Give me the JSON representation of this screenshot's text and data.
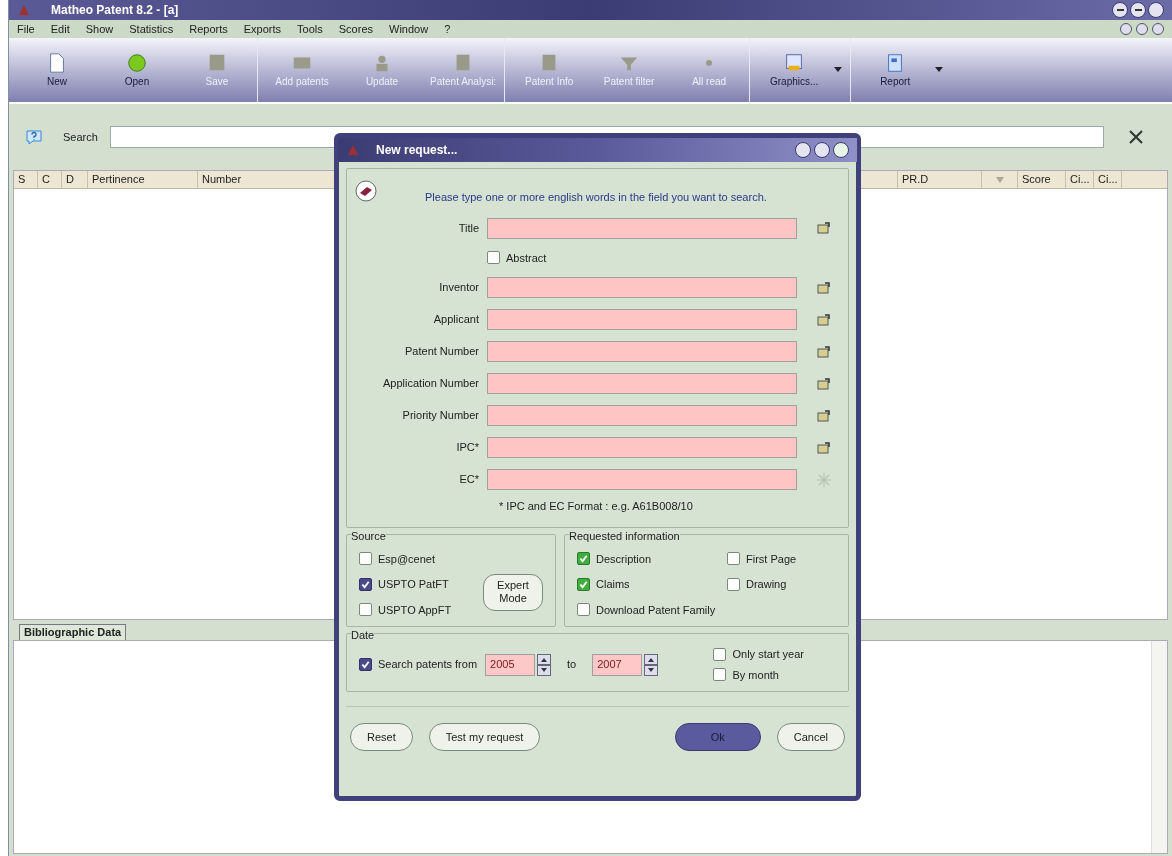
{
  "window": {
    "title": "Matheo Patent 8.2 - [a]"
  },
  "menu": [
    "File",
    "Edit",
    "Show",
    "Statistics",
    "Reports",
    "Exports",
    "Tools",
    "Scores",
    "Window",
    "?"
  ],
  "toolbar": [
    {
      "label": "New",
      "disabled": false,
      "dropdown": false
    },
    {
      "label": "Open",
      "disabled": false,
      "dropdown": false
    },
    {
      "label": "Save",
      "disabled": true,
      "dropdown": false
    },
    {
      "label": "Add patents",
      "disabled": true,
      "dropdown": false
    },
    {
      "label": "Update",
      "disabled": true,
      "dropdown": false
    },
    {
      "label": "Patent Analysi:",
      "disabled": true,
      "dropdown": false
    },
    {
      "label": "Patent Info",
      "disabled": true,
      "dropdown": false
    },
    {
      "label": "Patent filter",
      "disabled": true,
      "dropdown": false
    },
    {
      "label": "All read",
      "disabled": true,
      "dropdown": false
    },
    {
      "label": "Graphics...",
      "disabled": false,
      "dropdown": true
    },
    {
      "label": "Report",
      "disabled": false,
      "dropdown": true
    }
  ],
  "search": {
    "label": "Search"
  },
  "table": {
    "columns": [
      {
        "label": "S",
        "kind": "text"
      },
      {
        "label": "C",
        "kind": "text"
      },
      {
        "label": "D",
        "kind": "text"
      },
      {
        "label": "Pertinence",
        "kind": "text"
      },
      {
        "label": "Number",
        "kind": "text"
      },
      {
        "label": "PR.D",
        "kind": "text"
      },
      {
        "kind": "sort"
      },
      {
        "label": "Score",
        "kind": "text"
      },
      {
        "label": "Ci...",
        "kind": "text"
      },
      {
        "label": "Ci...",
        "kind": "text"
      }
    ]
  },
  "bottom_tabs": [
    {
      "label": "Bibliographic Data",
      "selected": true
    }
  ],
  "dialog": {
    "title": "New request...",
    "instruction": "Please type one or more english words in the field you want to search.",
    "fields": [
      {
        "label": "Title",
        "kind": "lookup"
      },
      {
        "label": "Inventor",
        "kind": "lookup"
      },
      {
        "label": "Applicant",
        "kind": "lookup"
      },
      {
        "label": "Patent Number",
        "kind": "lookup"
      },
      {
        "label": "Application Number",
        "kind": "lookup"
      },
      {
        "label": "Priority Number",
        "kind": "lookup"
      },
      {
        "label": "IPC*",
        "kind": "lookup"
      },
      {
        "label": "EC*",
        "kind": "spark"
      }
    ],
    "abstract": {
      "label": "Abstract",
      "checked": false
    },
    "note": "* IPC and EC Format : e.g. A61B008/10",
    "source": {
      "title": "Source",
      "options": [
        {
          "label": "Esp@cenet",
          "checked": false
        },
        {
          "label": "USPTO PatFT",
          "checked": true
        },
        {
          "label": "USPTO AppFT",
          "checked": false
        }
      ],
      "expert_button": "Expert Mode"
    },
    "requested": {
      "title": "Requested information",
      "options": [
        {
          "label": "Description",
          "checked": true
        },
        {
          "label": "First Page",
          "checked": false
        },
        {
          "label": "Claims",
          "checked": true
        },
        {
          "label": "Drawing",
          "checked": false
        },
        {
          "label": "Download Patent Family",
          "checked": false
        }
      ]
    },
    "date": {
      "title": "Date",
      "enable": {
        "label": "Search patents from",
        "checked": true
      },
      "from": "2005",
      "to_label": "to",
      "to": "2007",
      "options": [
        {
          "label": "Only start year",
          "checked": false
        },
        {
          "label": "By month",
          "checked": false
        }
      ]
    },
    "buttons": [
      {
        "label": "Reset",
        "primary": false
      },
      {
        "label": "Test my request",
        "primary": false
      },
      {
        "label": "Ok",
        "primary": true
      },
      {
        "label": "Cancel",
        "primary": false
      }
    ]
  }
}
